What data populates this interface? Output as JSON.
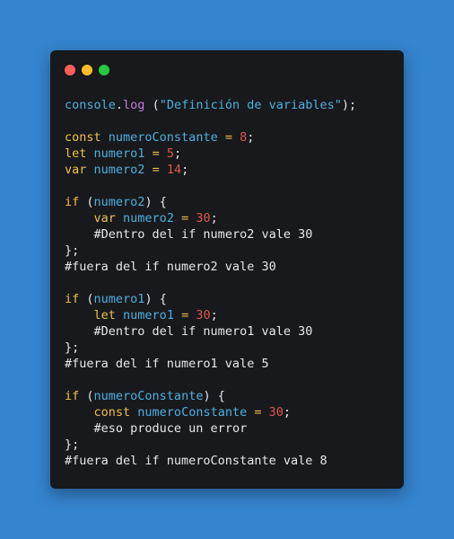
{
  "window": {
    "dots": [
      {
        "name": "close",
        "color": "#ff5f56"
      },
      {
        "name": "minimize",
        "color": "#ffbd2e"
      },
      {
        "name": "maximize",
        "color": "#27c93f"
      }
    ]
  },
  "code": {
    "lines": [
      [
        [
          "ident",
          "console"
        ],
        [
          "punct",
          "."
        ],
        [
          "method",
          "log"
        ],
        [
          "punct",
          " ("
        ],
        [
          "string",
          "\"Definición de variables\""
        ],
        [
          "punct",
          ");"
        ]
      ],
      [],
      [
        [
          "keyword",
          "const"
        ],
        [
          "plain",
          " "
        ],
        [
          "ident",
          "numeroConstante"
        ],
        [
          "plain",
          " "
        ],
        [
          "op",
          "="
        ],
        [
          "plain",
          " "
        ],
        [
          "number",
          "8"
        ],
        [
          "punct",
          ";"
        ]
      ],
      [
        [
          "keyword",
          "let"
        ],
        [
          "plain",
          " "
        ],
        [
          "ident",
          "numero1"
        ],
        [
          "plain",
          " "
        ],
        [
          "op",
          "="
        ],
        [
          "plain",
          " "
        ],
        [
          "number",
          "5"
        ],
        [
          "punct",
          ";"
        ]
      ],
      [
        [
          "keyword",
          "var"
        ],
        [
          "plain",
          " "
        ],
        [
          "ident",
          "numero2"
        ],
        [
          "plain",
          " "
        ],
        [
          "op",
          "="
        ],
        [
          "plain",
          " "
        ],
        [
          "number",
          "14"
        ],
        [
          "punct",
          ";"
        ]
      ],
      [],
      [
        [
          "keyword",
          "if"
        ],
        [
          "punct",
          " ("
        ],
        [
          "ident",
          "numero2"
        ],
        [
          "punct",
          ") {"
        ]
      ],
      [
        [
          "plain",
          "    "
        ],
        [
          "keyword",
          "var"
        ],
        [
          "plain",
          " "
        ],
        [
          "ident",
          "numero2"
        ],
        [
          "plain",
          " "
        ],
        [
          "op",
          "="
        ],
        [
          "plain",
          " "
        ],
        [
          "number",
          "30"
        ],
        [
          "punct",
          ";"
        ]
      ],
      [
        [
          "plain",
          "    "
        ],
        [
          "comment",
          "#Dentro del if numero2 vale 30"
        ]
      ],
      [
        [
          "punct",
          "};"
        ]
      ],
      [
        [
          "comment",
          "#fuera del if numero2 vale 30"
        ]
      ],
      [],
      [
        [
          "keyword",
          "if"
        ],
        [
          "punct",
          " ("
        ],
        [
          "ident",
          "numero1"
        ],
        [
          "punct",
          ") {"
        ]
      ],
      [
        [
          "plain",
          "    "
        ],
        [
          "keyword",
          "let"
        ],
        [
          "plain",
          " "
        ],
        [
          "ident",
          "numero1"
        ],
        [
          "plain",
          " "
        ],
        [
          "op",
          "="
        ],
        [
          "plain",
          " "
        ],
        [
          "number",
          "30"
        ],
        [
          "punct",
          ";"
        ]
      ],
      [
        [
          "plain",
          "    "
        ],
        [
          "comment",
          "#Dentro del if numero1 vale 30"
        ]
      ],
      [
        [
          "punct",
          "};"
        ]
      ],
      [
        [
          "comment",
          "#fuera del if numero1 vale 5"
        ]
      ],
      [],
      [
        [
          "keyword",
          "if"
        ],
        [
          "punct",
          " ("
        ],
        [
          "ident",
          "numeroConstante"
        ],
        [
          "punct",
          ") {"
        ]
      ],
      [
        [
          "plain",
          "    "
        ],
        [
          "keyword",
          "const"
        ],
        [
          "plain",
          " "
        ],
        [
          "ident",
          "numeroConstante"
        ],
        [
          "plain",
          " "
        ],
        [
          "op",
          "="
        ],
        [
          "plain",
          " "
        ],
        [
          "number",
          "30"
        ],
        [
          "punct",
          ";"
        ]
      ],
      [
        [
          "plain",
          "    "
        ],
        [
          "comment",
          "#eso produce un error"
        ]
      ],
      [
        [
          "punct",
          "};"
        ]
      ],
      [
        [
          "comment",
          "#fuera del if numeroConstante vale 8"
        ]
      ]
    ]
  }
}
